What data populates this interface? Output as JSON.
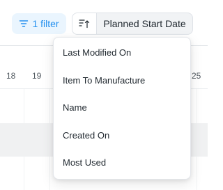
{
  "toolbar": {
    "filter_label": "1 filter",
    "filter_icon": "filter-lines-icon",
    "sort_direction_icon": "sort-ascending-icon",
    "sort_field_label": "Planned Start Date"
  },
  "timeline": {
    "day_labels": [
      "18",
      "19",
      "25"
    ]
  },
  "sort_menu": {
    "items": [
      {
        "label": "Last Modified On"
      },
      {
        "label": "Item To Manufacture"
      },
      {
        "label": "Name"
      },
      {
        "label": "Created On"
      },
      {
        "label": "Most Used"
      }
    ]
  },
  "colors": {
    "accent": "#2490ef",
    "accent_bg": "#eaf5fe",
    "text": "#1f272e",
    "muted_text": "#525a61",
    "border": "#dfe3e8",
    "bar_row_bg": "#f0f1f2"
  }
}
